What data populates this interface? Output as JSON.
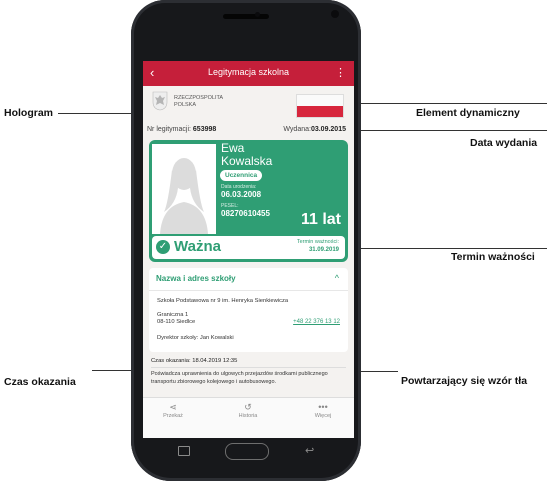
{
  "callouts": {
    "left_top": "Hologram",
    "left_bottom": "Czas okazania",
    "right1": "Element dynamiczny",
    "right2": "Data wydania",
    "right3": "Termin ważności",
    "right4": "Powtarzający się wzór tła"
  },
  "app": {
    "title": "Legitymacja szkolna",
    "back_icon": "‹",
    "menu_icon": "⋮",
    "country_line1": "RZECZPOSPOLITA",
    "country_line2": "POLSKA",
    "nr_label": "Nr legitymacji:",
    "nr_value": "653998",
    "issued_label": "Wydana:",
    "issued_value": "03.09.2015"
  },
  "card": {
    "first_name": "Ewa",
    "last_name": "Kowalska",
    "role": "Uczennica",
    "dob_label": "Data urodzenia:",
    "dob_value": "06.03.2008",
    "pesel_label": "PESEL:",
    "pesel_value": "08270610455",
    "age": "11 lat",
    "status": "Ważna",
    "expiry_label": "Termin ważności:",
    "expiry_value": "31.09.2019",
    "accent": "#2f9e74"
  },
  "school": {
    "header": "Nazwa i adres szkoły",
    "name": "Szkoła Podstawowa nr 9 im. Henryka Sienkiewicza",
    "address1": "Graniczna 1",
    "address2": "08-110 Siedlce",
    "phone": "+48 22 376 13 12",
    "director": "Dyrektor szkoły: Jan Kowalski"
  },
  "footer": {
    "shown_at": "Czas okazania: 18.04.2019 12:35",
    "note": "Poświadcza uprawnienia do ulgowych przejazdów środkami publicznego transportu zbiorowego kolejowego i autobusowego."
  },
  "nav": {
    "items": [
      {
        "label": "Przekaż",
        "icon": "share-icon",
        "glyph": "⋖"
      },
      {
        "label": "Historia",
        "icon": "history-icon",
        "glyph": "↺"
      },
      {
        "label": "Więcej",
        "icon": "more-icon",
        "glyph": "•••"
      }
    ]
  },
  "colors": {
    "brand_red": "#c51f3a",
    "accent_green": "#2f9e74"
  }
}
